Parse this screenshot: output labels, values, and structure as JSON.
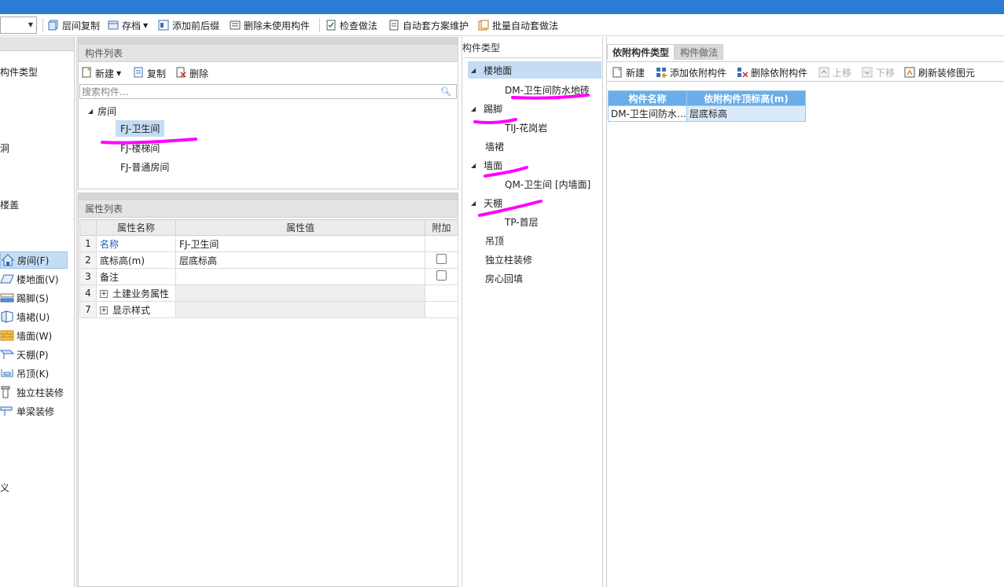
{
  "toolbar": {
    "combo_value": "",
    "items": [
      "层间复制",
      "存档",
      "添加前后缀",
      "删除未使用构件",
      "检查做法",
      "自动套方案维护",
      "批量自动套做法"
    ]
  },
  "sidebar": {
    "categories": [
      "构件类型",
      "洞",
      "楼盖",
      "义"
    ],
    "items": [
      {
        "label": "房间(F)",
        "icon": "house-icon"
      },
      {
        "label": "楼地面(V)",
        "icon": "floor-icon"
      },
      {
        "label": "踢脚(S)",
        "icon": "skirting-icon"
      },
      {
        "label": "墙裙(U)",
        "icon": "wainscot-icon"
      },
      {
        "label": "墙面(W)",
        "icon": "wall-icon"
      },
      {
        "label": "天棚(P)",
        "icon": "ceiling-icon"
      },
      {
        "label": "吊顶(K)",
        "icon": "suspended-ceiling-icon"
      },
      {
        "label": "独立柱装修",
        "icon": "column-icon"
      },
      {
        "label": "单梁装修",
        "icon": "beam-icon"
      }
    ]
  },
  "component_list": {
    "title": "构件列表",
    "actions": [
      "新建",
      "复制",
      "删除"
    ],
    "search_placeholder": "搜索构件...",
    "root": "房间",
    "children": [
      "FJ-卫生间",
      "FJ-楼梯间",
      "FJ-普通房间"
    ]
  },
  "property_list": {
    "title": "属性列表",
    "headers": [
      "属性名称",
      "属性值",
      "附加"
    ],
    "rows": [
      {
        "num": "1",
        "name": "名称",
        "value": "FJ-卫生间",
        "has_check": false
      },
      {
        "num": "2",
        "name": "底标高(m)",
        "value": "层底标高",
        "has_check": true
      },
      {
        "num": "3",
        "name": "备注",
        "value": "",
        "has_check": true
      },
      {
        "num": "4",
        "name": "土建业务属性",
        "value": "",
        "has_check": false,
        "group": true
      },
      {
        "num": "7",
        "name": "显示样式",
        "value": "",
        "has_check": false,
        "group": true
      }
    ]
  },
  "type_tree": {
    "title": "构件类型",
    "nodes": [
      {
        "label": "楼地面",
        "child": "DM-卫生间防水地砖"
      },
      {
        "label": "踢脚",
        "child": "TIJ-花岗岩"
      },
      {
        "label": "墙裙",
        "child": null
      },
      {
        "label": "墙面",
        "child": "QM-卫生间 [内墙面]"
      },
      {
        "label": "天棚",
        "child": "TP-首层"
      },
      {
        "label": "吊顶",
        "child": null
      },
      {
        "label": "独立柱装修",
        "child": null
      },
      {
        "label": "房心回填",
        "child": null
      }
    ]
  },
  "right_panel": {
    "tabs": [
      "依附构件类型",
      "构件做法"
    ],
    "actions": [
      "新建",
      "添加依附构件",
      "删除依附构件",
      "上移",
      "下移",
      "刷新装修图元"
    ],
    "table_headers": [
      "构件名称",
      "依附构件顶标高(m)"
    ],
    "table_rows": [
      [
        "DM-卫生间防水地砖",
        "层底标高"
      ]
    ]
  },
  "annotation_color": "#ff00ff"
}
